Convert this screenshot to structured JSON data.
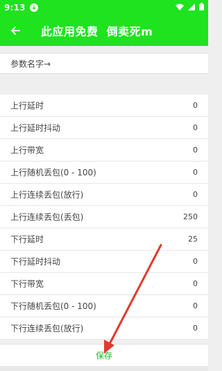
{
  "status_bar": {
    "time": "9:13",
    "icons": [
      "download-icon",
      "wifi-icon",
      "signal-icon",
      "battery-icon"
    ]
  },
  "app_bar": {
    "title": "此应用免费  倒卖死m",
    "back_icon": "arrow-left-icon"
  },
  "param": {
    "label": "参数名字→"
  },
  "settings": [
    {
      "label": "上行延时",
      "value": "0"
    },
    {
      "label": "上行延时抖动",
      "value": "0"
    },
    {
      "label": "上行带宽",
      "value": "0"
    },
    {
      "label": "上行随机丢包(0 - 100)",
      "value": "0"
    },
    {
      "label": "上行连续丢包(放行)",
      "value": "0"
    },
    {
      "label": "上行连续丢包(丢包)",
      "value": "250"
    },
    {
      "label": "下行延时",
      "value": "25"
    },
    {
      "label": "下行延时抖动",
      "value": "0"
    },
    {
      "label": "下行带宽",
      "value": "0"
    },
    {
      "label": "下行随机丢包(0 - 100)",
      "value": "0"
    },
    {
      "label": "下行连续丢包(放行)",
      "value": "0"
    }
  ],
  "save": {
    "label": "保存"
  },
  "colors": {
    "primary": "#1ee31e",
    "save_text": "#22b722",
    "annotation_arrow": "#e03a2e"
  }
}
